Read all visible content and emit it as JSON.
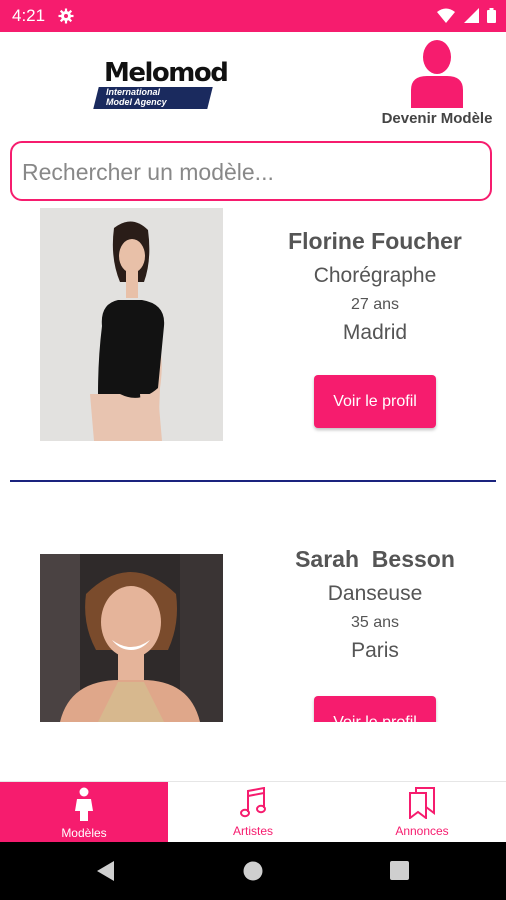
{
  "status_bar": {
    "time": "4:21"
  },
  "header": {
    "logo_word": "Melomod",
    "logo_sub_line1": "International",
    "logo_sub_line2": "Model Agency",
    "become_model_label": "Devenir Modèle"
  },
  "search": {
    "placeholder": "Rechercher un modèle..."
  },
  "models": [
    {
      "name": "Florine Foucher",
      "job": "Chorégraphe",
      "age": "27 ans",
      "city": "Madrid",
      "button": "Voir le profil"
    },
    {
      "name": "Sarah  Besson",
      "job": "Danseuse",
      "age": "35 ans",
      "city": "Paris",
      "button": "Voir le profil"
    }
  ],
  "bottom_nav": [
    {
      "label": "Modèles",
      "icon": "person-icon",
      "active": true
    },
    {
      "label": "Artistes",
      "icon": "music-note-icon",
      "active": false
    },
    {
      "label": "Annonces",
      "icon": "bookmarks-icon",
      "active": false
    }
  ],
  "colors": {
    "accent": "#f61c6e",
    "divider": "#1a237e",
    "logo_band": "#1a2a5e"
  }
}
